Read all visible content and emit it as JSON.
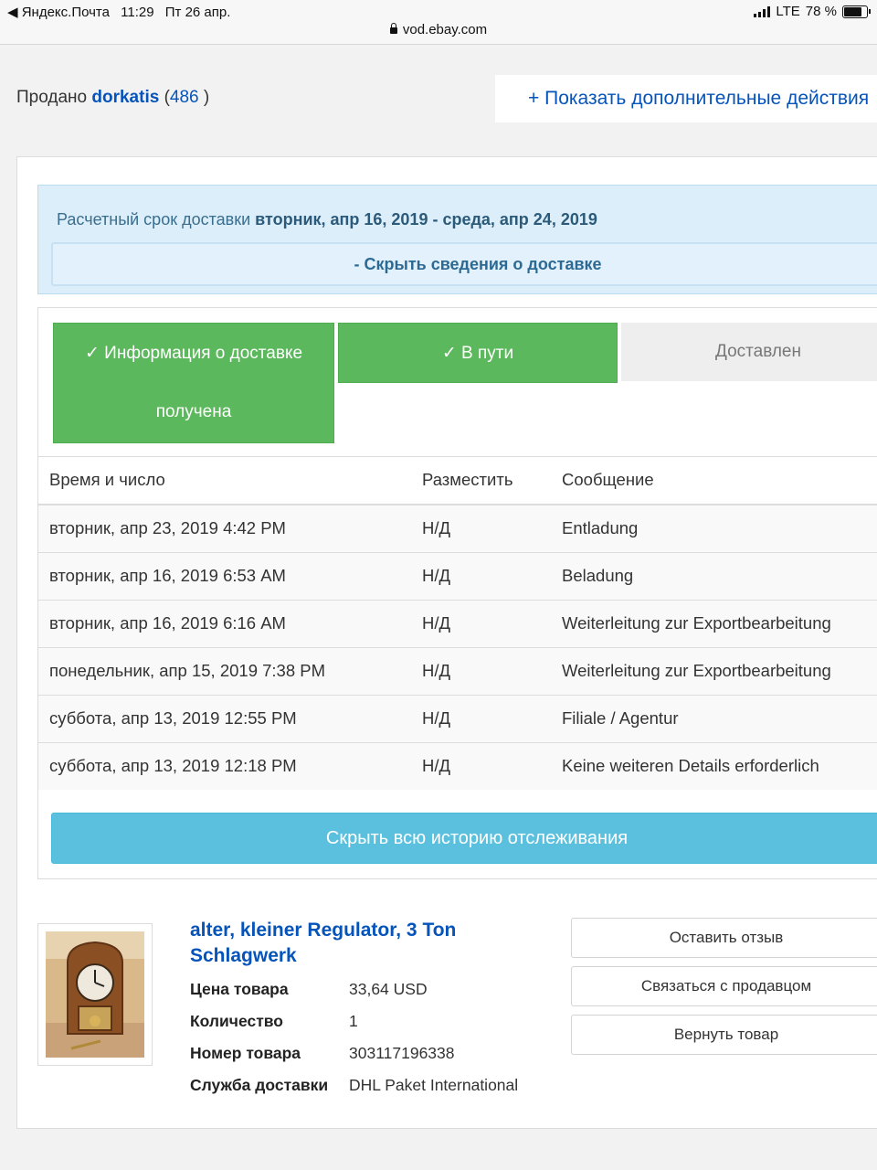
{
  "status": {
    "back_app": "◀ Яндекс.Почта",
    "time": "11:29",
    "date": "Пт 26 апр.",
    "network": "LTE",
    "battery": "78 %",
    "url": "vod.ebay.com"
  },
  "header": {
    "sold_prefix": "Продано",
    "seller": "dorkatis",
    "count_open": " (",
    "count": "486",
    "count_close": " )",
    "more_actions": "+ Показать дополнительные действия"
  },
  "delivery": {
    "estimate_label": "Расчетный срок доставки",
    "estimate_range": "вторник, апр 16, 2019 - среда, апр 24, 2019",
    "hide_details": "- Скрыть сведения о доставке"
  },
  "steps": [
    {
      "label": "✓ Информация о доставке получена",
      "state": "done"
    },
    {
      "label": "✓ В пути",
      "state": "done"
    },
    {
      "label": "Доставлен",
      "state": "pending"
    }
  ],
  "tracking_table": {
    "headers": [
      "Время и число",
      "Разместить",
      "Сообщение"
    ],
    "rows": [
      [
        "вторник, апр 23, 2019 4:42 PM",
        "Н/Д",
        "Entladung"
      ],
      [
        "вторник, апр 16, 2019 6:53 AM",
        "Н/Д",
        "Beladung"
      ],
      [
        "вторник, апр 16, 2019 6:16 AM",
        "Н/Д",
        "Weiterleitung zur Exportbearbeitung"
      ],
      [
        "понедельник, апр 15, 2019 7:38 PM",
        "Н/Д",
        "Weiterleitung zur Exportbearbeitung"
      ],
      [
        "суббота, апр 13, 2019 12:55 PM",
        "Н/Д",
        "Filiale / Agentur"
      ],
      [
        "суббота, апр 13, 2019 12:18 PM",
        "Н/Д",
        "Keine weiteren Details erforderlich"
      ]
    ]
  },
  "hide_history": "Скрыть всю историю отслеживания",
  "item": {
    "title": "alter, kleiner Regulator, 3 Ton Schlagwerk",
    "fields": [
      {
        "label": "Цена товара",
        "value": "33,64 USD"
      },
      {
        "label": "Количество",
        "value": "1"
      },
      {
        "label": "Номер товара",
        "value": "303117196338"
      },
      {
        "label": "Служба доставки",
        "value": "DHL Paket International"
      }
    ]
  },
  "actions": [
    "Оставить отзыв",
    "Связаться с продавцом",
    "Вернуть товар"
  ],
  "colors": {
    "link_blue": "#0654ba",
    "step_green": "#5cb85c",
    "info_blue": "#5bc0de",
    "delivery_bg": "#dceef9"
  }
}
